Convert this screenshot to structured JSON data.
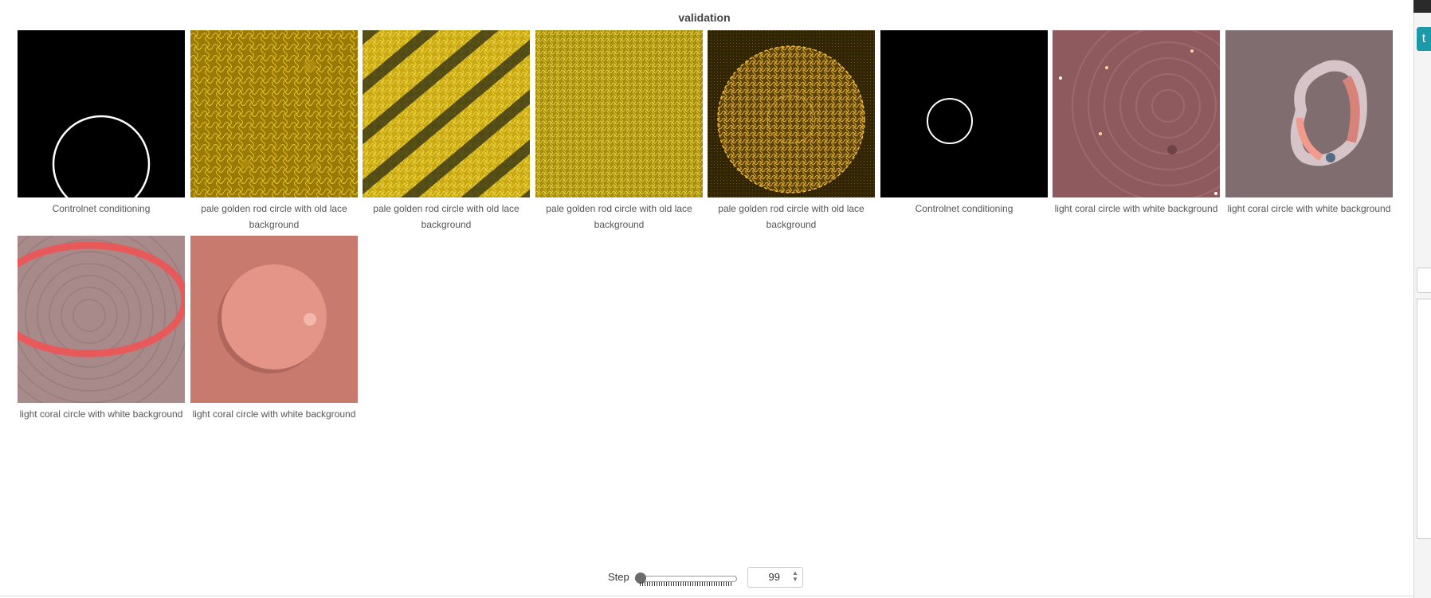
{
  "panel": {
    "title": "validation"
  },
  "images": [
    {
      "caption": "Controlnet conditioning",
      "kind": "cond-large"
    },
    {
      "caption": "pale golden rod circle with old lace background",
      "kind": "gold-lace"
    },
    {
      "caption": "pale golden rod circle with old lace background",
      "kind": "gold-stripes"
    },
    {
      "caption": "pale golden rod circle with old lace background",
      "kind": "gold-fine"
    },
    {
      "caption": "pale golden rod circle with old lace background",
      "kind": "gold-doily"
    },
    {
      "caption": "Controlnet conditioning",
      "kind": "cond-small"
    },
    {
      "caption": "light coral circle with white background",
      "kind": "coral-rings"
    },
    {
      "caption": "light coral circle with white background",
      "kind": "coral-ribbon"
    },
    {
      "caption": "light coral circle with white background",
      "kind": "coral-oval"
    },
    {
      "caption": "light coral circle with white background",
      "kind": "coral-disc"
    }
  ],
  "step": {
    "label": "Step",
    "value": "99",
    "slider_fraction": 0.0
  },
  "edge": {
    "button_glyph": "t"
  }
}
